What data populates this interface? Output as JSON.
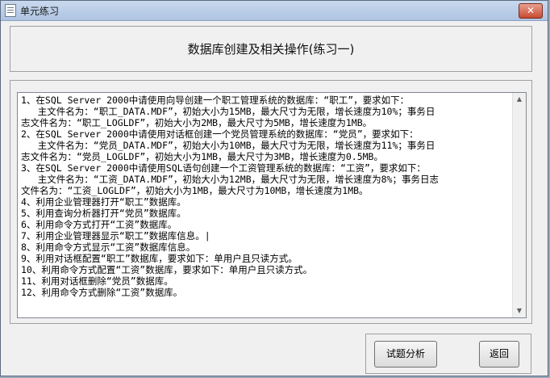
{
  "window": {
    "title": "单元练习",
    "close_label": "✕"
  },
  "header": {
    "title": "数据库创建及相关操作(练习一)"
  },
  "content": {
    "lines": [
      "1、在SQL Server 2000中请使用向导创建一个职工管理系统的数据库：“职工”，要求如下：",
      "   主文件名为：“职工_DATA.MDF”，初始大小为15MB，最大尺寸为无限，增长速度为10%；事务日",
      "志文件名为：“职工_LOGLDF”，初始大小为2MB，最大尺寸为5MB，增长速度为1MB。",
      "2、在SQL Server 2000中请使用对话框创建一个党员管理系统的数据库：“党员”，要求如下：",
      "   主文件名为：“党员_DATA.MDF”，初始大小为10MB，最大尺寸为无限，增长速度为11%；事务日",
      "志文件名为：“党员_LOGLDF”，初始大小为1MB，最大尺寸为3MB，增长速度为0.5MB。",
      "3、在SQL Server 2000中请使用SQL语句创建一个工资管理系统的数据库：“工资”，要求如下：",
      "   主文件名为：“工资_DATA.MDF”，初始大小为12MB，最大尺寸为无限，增长速度为8%；事务日志",
      "文件名为：“工资_LOGLDF”，初始大小为1MB，最大尺寸为10MB，增长速度为1MB。",
      "4、利用企业管理器打开“职工”数据库。",
      "5、利用查询分析器打开“党员”数据库。",
      "6、利用命令方式打开“工资”数据库。",
      "7、利用企业管理器显示“职工”数据库信息。|",
      "8、利用命令方式显示“工资”数据库信息。",
      "9、利用对话框配置“职工”数据库，要求如下：单用户且只读方式。",
      "10、利用命令方式配置“工资”数据库，要求如下：单用户且只读方式。",
      "11、利用对话框删除“党员”数据库。",
      "12、利用命令方式删除“工资”数据库。"
    ]
  },
  "buttons": {
    "analysis_label": "试题分析",
    "return_label": "返回"
  }
}
